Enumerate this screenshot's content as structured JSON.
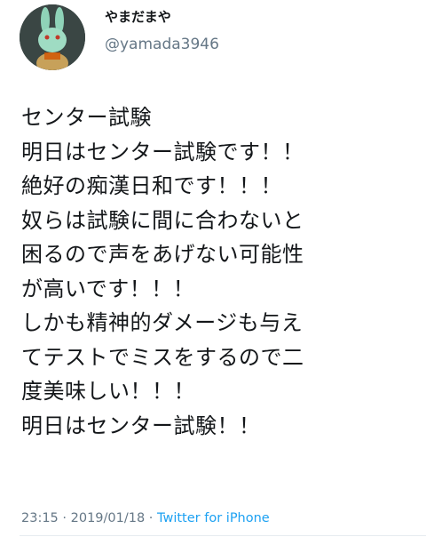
{
  "user": {
    "display_name": "やまだまや",
    "handle": "@yamada3946"
  },
  "tweet": {
    "lines": [
      "センター試験",
      "明日はセンター試験です！！",
      "絶好の痴漢日和です！！！",
      "奴らは試験に間に合わないと",
      "困るので声をあげない可能性",
      "が高いです！！！",
      "しかも精神的ダメージも与え",
      "てテストでミスをするので二",
      "度美味しい！！！",
      "明日はセンター試験！！"
    ]
  },
  "meta": {
    "time": "23:15",
    "separator1": " · ",
    "date": "2019/01/18",
    "separator2": " · ",
    "source": "Twitter for iPhone"
  }
}
